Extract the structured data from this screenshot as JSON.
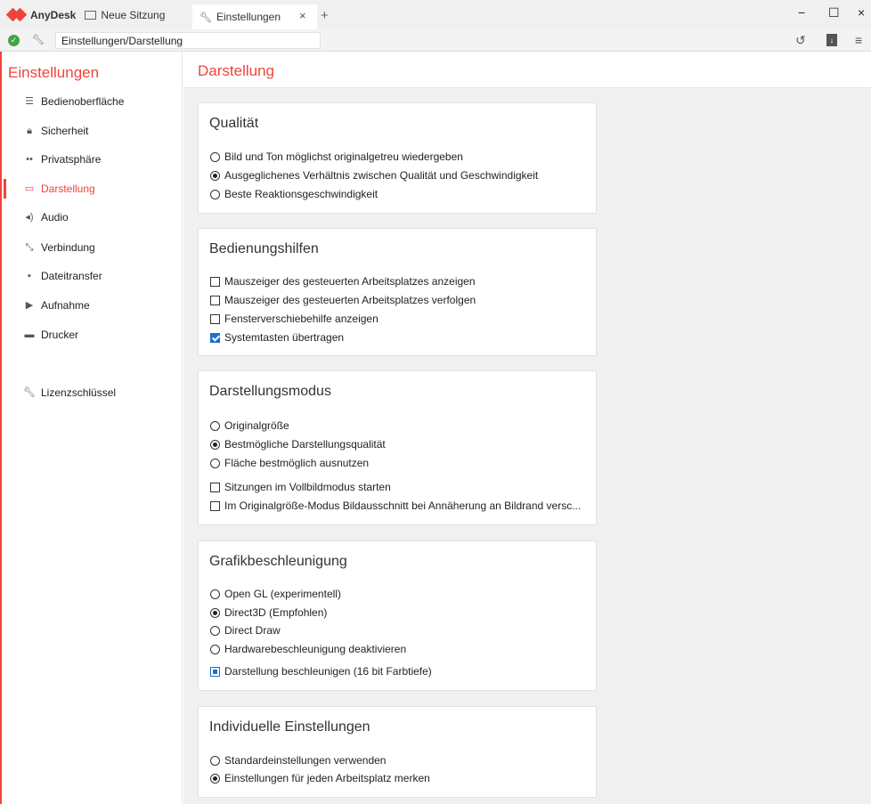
{
  "titlebar": {
    "brand": "AnyDesk",
    "tabs": [
      {
        "label": "Neue Sitzung"
      },
      {
        "label": "Einstellungen"
      }
    ],
    "close_tab": "×",
    "add_tab": "+",
    "minimize": "−",
    "maximize": "☐",
    "close": "×"
  },
  "addressbar": {
    "value": "Einstellungen/Darstellung"
  },
  "sidebar": {
    "title": "Einstellungen",
    "items": [
      {
        "label": "Bedienoberfläche",
        "icon": "list-icon"
      },
      {
        "label": "Sicherheit",
        "icon": "lock-icon"
      },
      {
        "label": "Privatsphäre",
        "icon": "glasses-icon"
      },
      {
        "label": "Darstellung",
        "icon": "monitor-icon",
        "active": true
      },
      {
        "label": "Audio",
        "icon": "speaker-icon"
      },
      {
        "label": "Verbindung",
        "icon": "connection-icon"
      },
      {
        "label": "Dateitransfer",
        "icon": "file-icon"
      },
      {
        "label": "Aufnahme",
        "icon": "video-icon"
      },
      {
        "label": "Drucker",
        "icon": "printer-icon"
      },
      {
        "label": "Lizenzschlüssel",
        "icon": "key-icon"
      }
    ]
  },
  "main": {
    "title": "Darstellung",
    "cards": [
      {
        "title": "Qualität",
        "options": [
          {
            "type": "radio",
            "label": "Bild und Ton möglichst originalgetreu wiedergeben",
            "checked": false
          },
          {
            "type": "radio",
            "label": "Ausgeglichenes Verhältnis zwischen Qualität und Geschwindigkeit",
            "checked": true
          },
          {
            "type": "radio",
            "label": "Beste Reaktionsgeschwindigkeit",
            "checked": false
          }
        ]
      },
      {
        "title": "Bedienungshilfen",
        "options": [
          {
            "type": "check",
            "label": "Mauszeiger des gesteuerten Arbeitsplatzes anzeigen",
            "checked": false
          },
          {
            "type": "check",
            "label": "Mauszeiger des gesteuerten Arbeitsplatzes verfolgen",
            "checked": false
          },
          {
            "type": "check",
            "label": "Fensterverschiebehilfe anzeigen",
            "checked": false
          },
          {
            "type": "check",
            "label": "Systemtasten übertragen",
            "checked": true
          }
        ]
      },
      {
        "title": "Darstellungsmodus",
        "options": [
          {
            "type": "radio",
            "label": "Originalgröße",
            "checked": false
          },
          {
            "type": "radio",
            "label": "Bestmögliche Darstellungsqualität",
            "checked": true
          },
          {
            "type": "radio",
            "label": "Fläche bestmöglich ausnutzen",
            "checked": false
          },
          {
            "type": "check",
            "label": "Sitzungen im Vollbildmodus starten",
            "checked": false
          },
          {
            "type": "check",
            "label": "Im Originalgröße-Modus Bildausschnitt bei Annäherung an Bildrand versc...",
            "checked": false
          }
        ]
      },
      {
        "title": "Grafikbeschleunigung",
        "options": [
          {
            "type": "radio",
            "label": "Open GL (experimentell)",
            "checked": false
          },
          {
            "type": "radio",
            "label": "Direct3D (Empfohlen)",
            "checked": true
          },
          {
            "type": "radio",
            "label": "Direct Draw",
            "checked": false
          },
          {
            "type": "radio",
            "label": "Hardwarebeschleunigung deaktivieren",
            "checked": false
          },
          {
            "type": "check",
            "label": "Darstellung beschleunigen (16 bit Farbtiefe)",
            "checked": "partial"
          }
        ]
      },
      {
        "title": "Individuelle Einstellungen",
        "options": [
          {
            "type": "radio",
            "label": "Standardeinstellungen verwenden",
            "checked": false
          },
          {
            "type": "radio",
            "label": "Einstellungen für jeden Arbeitsplatz merken",
            "checked": true
          }
        ]
      }
    ]
  },
  "colors": {
    "accent": "#ef443b",
    "checkbox": "#1b6fd1",
    "status_ok": "#45a444"
  }
}
